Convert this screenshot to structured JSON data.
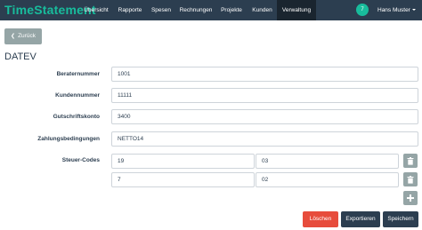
{
  "app": {
    "logo": "TimeStatement"
  },
  "nav": {
    "items": [
      "Übersicht",
      "Rapporte",
      "Spesen",
      "Rechnungen",
      "Projekte",
      "Kunden",
      "Verwaltung"
    ],
    "notification_count": "7",
    "user_name": "Hans Muster"
  },
  "back_label": "Zurück",
  "page_title": "DATEV",
  "form": {
    "berater_label": "Beraternummer",
    "berater_value": "1001",
    "kunden_label": "Kundennummer",
    "kunden_value": "11111",
    "gutschrift_label": "Gutschriftskonto",
    "gutschrift_value": "3400",
    "zahlung_label": "Zahlungsbedingungen",
    "zahlung_value": "NETTO14",
    "steuer_label": "Steuer-Codes",
    "steuer_codes": [
      {
        "code": "19",
        "value": "03"
      },
      {
        "code": "7",
        "value": "02"
      }
    ]
  },
  "actions": {
    "delete": "Löschen",
    "export": "Exportieren",
    "save": "Speichern"
  }
}
